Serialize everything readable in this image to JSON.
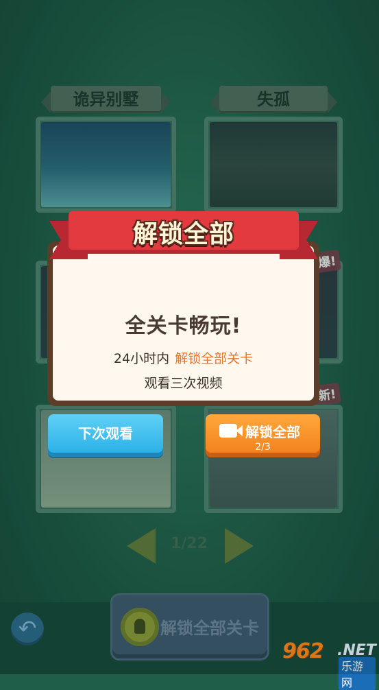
{
  "levels": [
    {
      "title": "诡异别墅"
    },
    {
      "title": "失孤"
    }
  ],
  "tags": {
    "hot": "爆!",
    "new": "新!"
  },
  "pager": {
    "text": "1/22"
  },
  "bottom": {
    "unlock_all_label": "解锁全部关卡"
  },
  "watermark": {
    "main": "962",
    "net": ".NET",
    "sub": "乐游网"
  },
  "modal": {
    "title": "解锁全部",
    "headline": "全关卡畅玩!",
    "line1_prefix": "24小时内",
    "line1_accent": "解锁全部关卡",
    "line2": "观看三次视频",
    "next_button": "下次观看",
    "unlock_button": "解锁全部",
    "progress": "2/3"
  },
  "colors": {
    "accent_orange": "#f27f1c",
    "accent_blue": "#27aee6",
    "ribbon_red": "#e23a3f"
  }
}
